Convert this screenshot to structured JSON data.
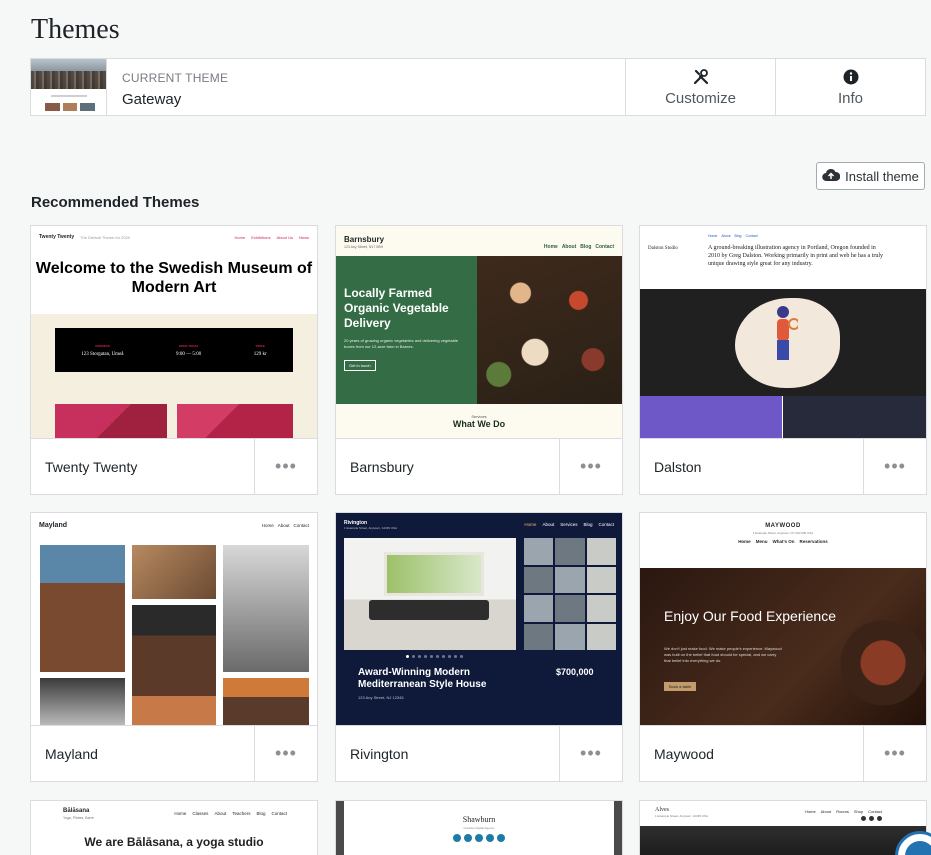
{
  "page": {
    "title": "Themes"
  },
  "current_theme": {
    "label": "CURRENT THEME",
    "name": "Gateway",
    "actions": [
      {
        "label": "Customize",
        "icon": "tools-icon"
      },
      {
        "label": "Info",
        "icon": "info-icon"
      }
    ]
  },
  "install_button": {
    "label": "Install theme",
    "icon": "cloud-upload-icon"
  },
  "section": {
    "title": "Recommended Themes"
  },
  "themes": [
    {
      "name": "Twenty Twenty",
      "more": "•••",
      "preview": {
        "site_title": "Twenty Twenty",
        "tagline": "The Default Theme for 2020",
        "nav": [
          "Home",
          "Exhibitions",
          "About Us",
          "News"
        ],
        "headline": "Welcome to the Swedish Museum of Modern Art",
        "info": [
          {
            "label": "ADDRESS",
            "value": "123 Storgatan, Umeå"
          },
          {
            "label": "OPEN TODAY",
            "value": "9:00 — 5:00"
          },
          {
            "label": "PRICE",
            "value": "129 kr"
          }
        ]
      }
    },
    {
      "name": "Barnsbury",
      "more": "•••",
      "preview": {
        "site_title": "Barnsbury",
        "address": "123 Any Street, N17 0BH",
        "nav": [
          "Home",
          "About",
          "Blog",
          "Contact"
        ],
        "headline": "Locally Farmed Organic Vegetable Delivery",
        "body": "20 years of growing organic vegetables and delivering vegetable boxes from our 12-acre farm in Barnes.",
        "cta": "Get in touch",
        "section_label": "Services",
        "section_title": "What We Do"
      }
    },
    {
      "name": "Dalston",
      "more": "•••",
      "preview": {
        "site_title": "Dalston Studio",
        "nav": [
          "Home",
          "About",
          "Blog",
          "Contact"
        ],
        "intro": "A ground-breaking illustration agency in Portland, Oregon founded in 2010 by Greg Dalston. Working primarily in print and web he has a truly unique drawing style great for any industry."
      }
    },
    {
      "name": "Mayland",
      "more": "•••",
      "preview": {
        "site_title": "Mayland",
        "nav": [
          "Home",
          "About",
          "Contact"
        ]
      }
    },
    {
      "name": "Rivington",
      "more": "•••",
      "preview": {
        "site_title": "Rivington",
        "address": "1 Example Street, Anytown, 12345 USA",
        "nav": [
          "Home",
          "About",
          "Services",
          "Blog",
          "Contact"
        ],
        "headline": "Award-Winning Modern Mediterranean Style House",
        "price": "$700,000",
        "listing_address": "123 Any Street, NJ 12345"
      }
    },
    {
      "name": "Maywood",
      "more": "•••",
      "preview": {
        "site_title": "MAYWOOD",
        "address": "1 Example Street, Anytown, NY 000 000 USA",
        "nav": [
          "Home",
          "Menu",
          "What's On",
          "Reservations"
        ],
        "headline": "Enjoy Our Food Experience",
        "body": "We don't just make food. We make people's experience. Maywood was built on the belief that food should be special, and we carry that belief into everything we do.",
        "cta": "Book a table"
      }
    },
    {
      "name": "Bālāsana",
      "preview": {
        "site_title": "Bālāsana",
        "tagline": "Yoga, Pilates, Barre",
        "nav": [
          "Home",
          "Classes",
          "About",
          "Teachers",
          "Blog",
          "Contact"
        ],
        "headline": "We are Bālāsana, a yoga studio"
      }
    },
    {
      "name": "Shawburn",
      "preview": {
        "site_title": "Shawburn",
        "tagline": "Creative Digital Agency"
      }
    },
    {
      "name": "Alves",
      "preview": {
        "site_title": "Alves",
        "address": "1 Example Street, Anytown, 12345 USA",
        "nav": [
          "Home",
          "About",
          "Rooms",
          "Shop",
          "Contact"
        ]
      }
    }
  ]
}
